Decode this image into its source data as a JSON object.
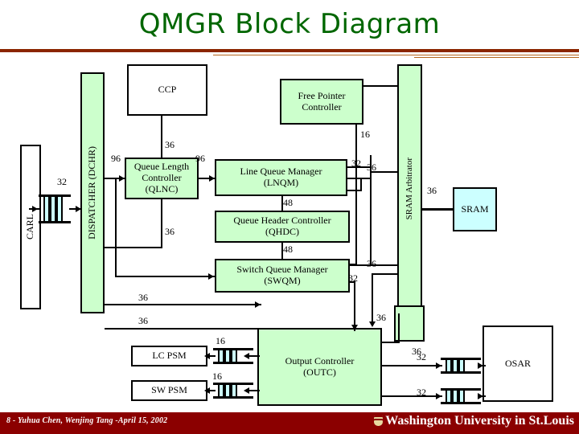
{
  "slide": {
    "title": "QMGR Block Diagram",
    "footer_text": "8 - Yuhua Chen, Wenjing Tang -April 15, 2002",
    "logo_text": "Washington University in St.Louis",
    "accent_color": "#8B0000",
    "title_color": "#006600",
    "block_fill_green": "#CCFFCC",
    "block_fill_cyan": "#CCFFFF"
  },
  "blocks": {
    "carl": "CARL",
    "dispatcher": "DISPATCHER (DCHR)",
    "ccp": "CCP",
    "qlnc_line1": "Queue Length",
    "qlnc_line2": "Controller",
    "qlnc_line3": "(QLNC)",
    "fpc_line1": "Free Pointer",
    "fpc_line2": "Controller",
    "lnqm_line1": "Line Queue Manager",
    "lnqm_line2": "(LNQM)",
    "qhdc_line1": "Queue Header Controller",
    "qhdc_line2": "(QHDC)",
    "swqm_line1": "Switch Queue Manager",
    "swqm_line2": "(SWQM)",
    "sram_arbitrator": "SRAM Arbitrator",
    "sram": "SRAM",
    "lc_psm": "LC PSM",
    "sw_psm": "SW PSM",
    "outc_line1": "Output Controller",
    "outc_line2": "(OUTC)",
    "osar": "OSAR"
  },
  "bus_labels": {
    "carl_to_dchr": "32",
    "dchr_to_qlnc": "96",
    "ccp_to_qlnc": "36",
    "qlnc_to_lnqm": "96",
    "qlnc_down": "36",
    "fpc_down": "16",
    "lnqm_right_32": "32",
    "lnqm_right_36": "36",
    "lnqm_to_qhdc": "48",
    "qhdc_to_swqm": "48",
    "swqm_right_36": "36",
    "swqm_right_32": "32",
    "arb_to_sram": "36",
    "dchr_out_36_a": "36",
    "dchr_out_36_b": "36",
    "arb_down_36": "36",
    "outc_fpc_36": "36",
    "outc_to_lcpsm": "16",
    "outc_to_swpsm": "16",
    "outc_to_osar_1": "32",
    "outc_to_osar_2": "32"
  }
}
